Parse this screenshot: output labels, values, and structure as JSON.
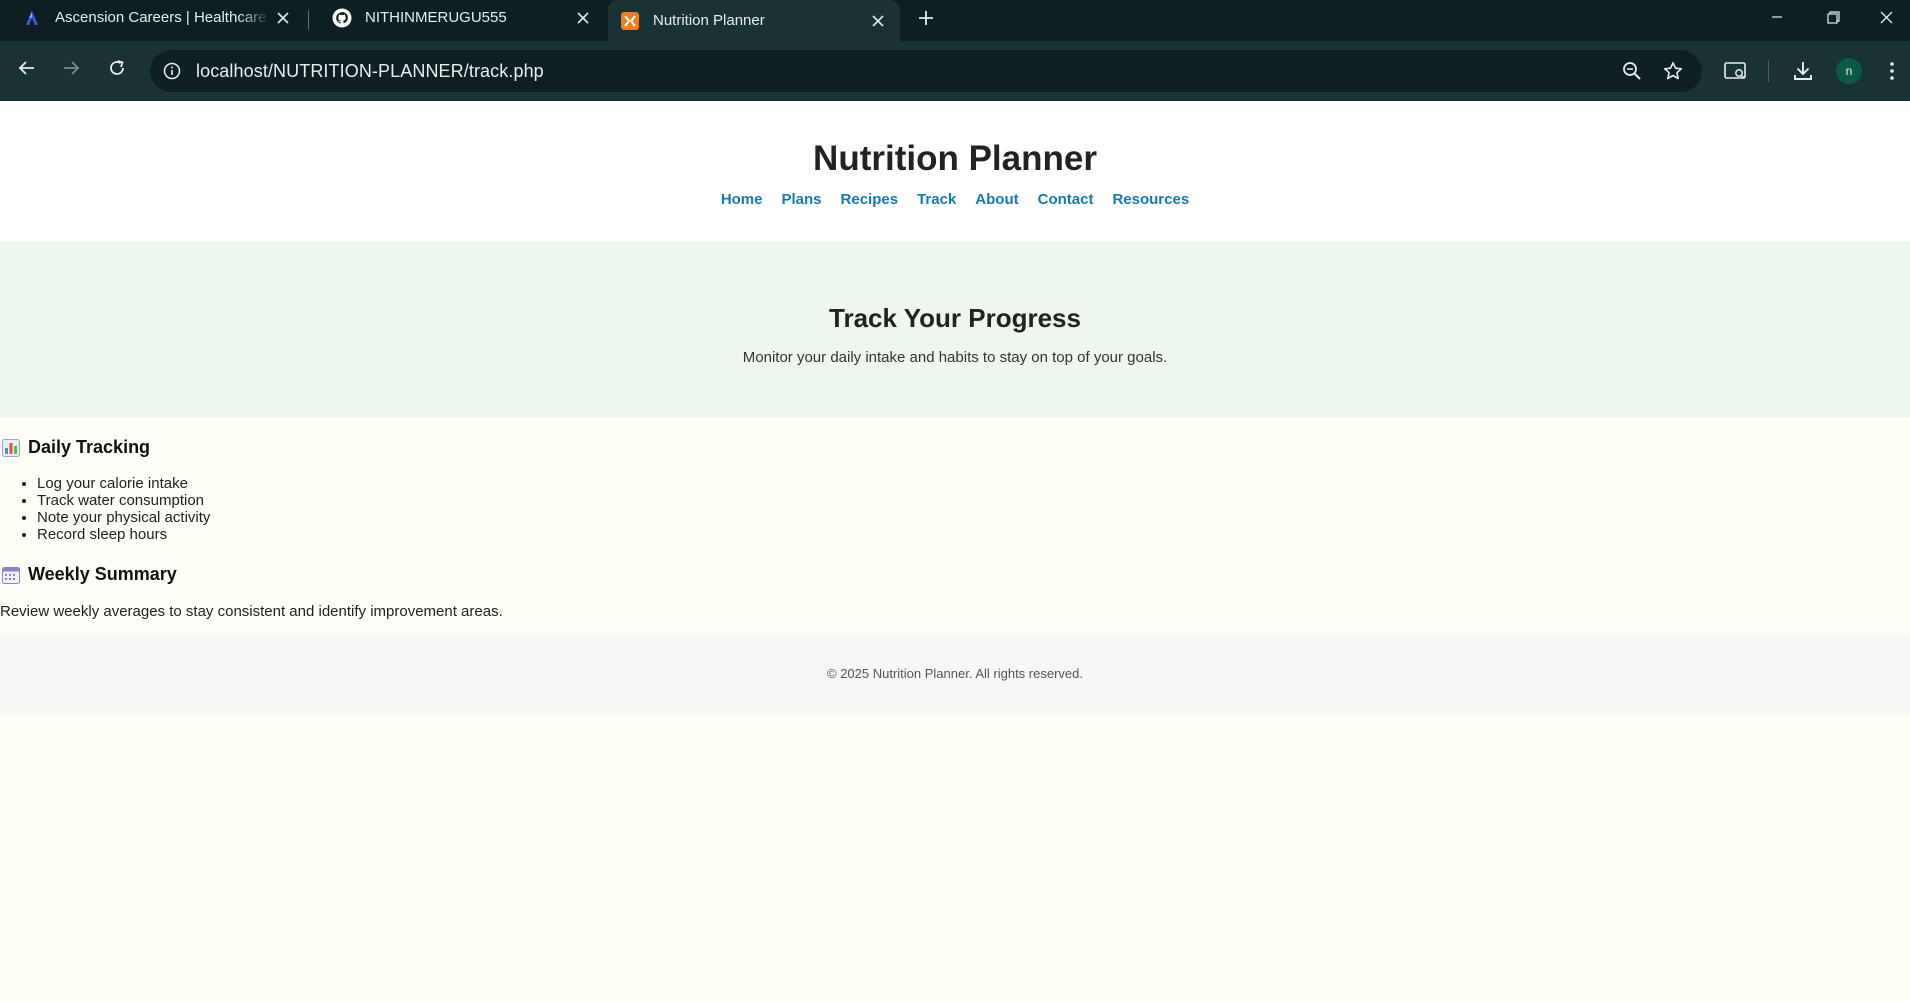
{
  "browser": {
    "tabs": [
      {
        "title": "Ascension Careers | Healthcare Jobs",
        "favicon": "ascension-logo"
      },
      {
        "title": "NITHINMERUGU555",
        "favicon": "github-logo"
      },
      {
        "title": "Nutrition Planner",
        "favicon": "xampp-logo",
        "active": true
      }
    ],
    "url": "localhost/NUTRITION-PLANNER/track.php",
    "profile_initial": "n",
    "colors": {
      "tabstrip": "#0d1f22",
      "toolbar": "#193234",
      "avatar": "#0b5a46"
    }
  },
  "site": {
    "title": "Nutrition Planner",
    "nav": [
      "Home",
      "Plans",
      "Recipes",
      "Track",
      "About",
      "Contact",
      "Resources"
    ],
    "link_color": "#1578b7"
  },
  "hero": {
    "heading": "Track Your Progress",
    "subheading": "Monitor your daily intake and habits to stay on top of your goals.",
    "background": "#eef7ee"
  },
  "daily": {
    "icon": "bar-chart-emoji",
    "title": "Daily Tracking",
    "items": [
      "Log your calorie intake",
      "Track water consumption",
      "Note your physical activity",
      "Record sleep hours"
    ]
  },
  "weekly": {
    "icon": "calendar-emoji",
    "title": "Weekly Summary",
    "text": "Review weekly averages to stay consistent and identify improvement areas."
  },
  "footer": {
    "text": "© 2025 Nutrition Planner. All rights reserved."
  }
}
